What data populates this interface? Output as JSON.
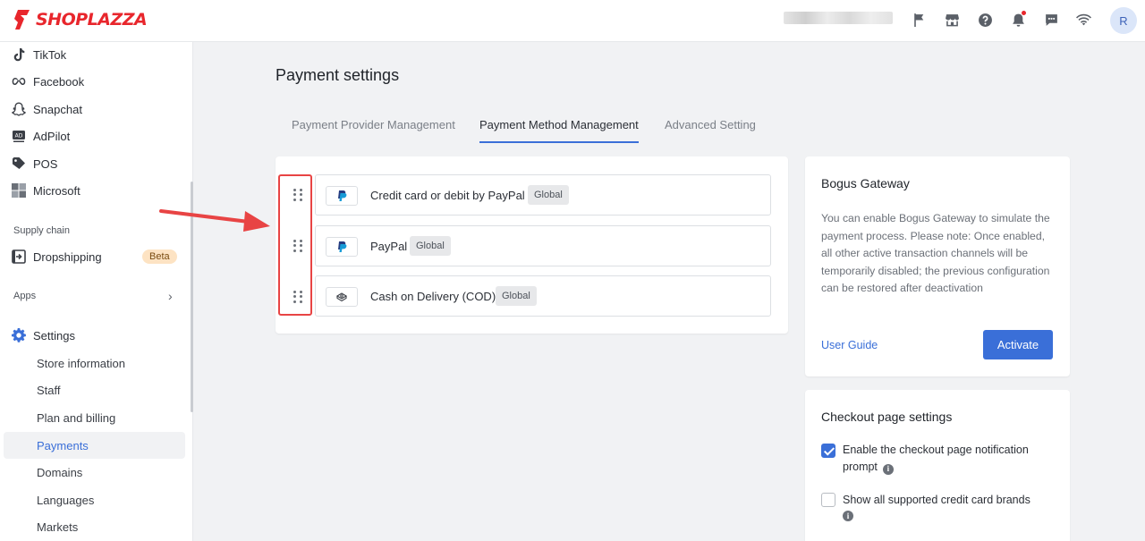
{
  "brand": {
    "name": "SHOPLAZZA"
  },
  "topbar": {
    "avatar_letter": "R",
    "icons": [
      "flag-icon",
      "store-icon",
      "help-icon",
      "bell-icon",
      "message-icon",
      "wifi-icon"
    ]
  },
  "sidebar": {
    "channels": [
      {
        "label": "TikTok",
        "icon": "tiktok-icon"
      },
      {
        "label": "Facebook",
        "icon": "meta-icon"
      },
      {
        "label": "Snapchat",
        "icon": "snapchat-icon"
      },
      {
        "label": "AdPilot",
        "icon": "adpilot-icon"
      },
      {
        "label": "POS",
        "icon": "tag-icon"
      },
      {
        "label": "Microsoft",
        "icon": "microsoft-icon"
      }
    ],
    "supply_chain_heading": "Supply chain",
    "dropshipping": {
      "label": "Dropshipping",
      "badge": "Beta"
    },
    "apps_label": "Apps",
    "settings_label": "Settings",
    "settings_items": [
      {
        "label": "Store information",
        "active": false
      },
      {
        "label": "Staff",
        "active": false
      },
      {
        "label": "Plan and billing",
        "active": false
      },
      {
        "label": "Payments",
        "active": true
      },
      {
        "label": "Domains",
        "active": false
      },
      {
        "label": "Languages",
        "active": false
      },
      {
        "label": "Markets",
        "active": false
      }
    ]
  },
  "main": {
    "title": "Payment settings",
    "tabs": [
      {
        "label": "Payment Provider Management",
        "active": false
      },
      {
        "label": "Payment Method Management",
        "active": true
      },
      {
        "label": "Advanced Setting",
        "active": false
      }
    ],
    "methods": [
      {
        "name": "Credit card or debit by PayPal",
        "tag": "Global",
        "logo": "paypal-icon"
      },
      {
        "name": "PayPal",
        "tag": "Global",
        "logo": "paypal-icon"
      },
      {
        "name": "Cash on Delivery (COD)",
        "tag": "Global",
        "logo": "cash-icon"
      }
    ]
  },
  "bogus_gateway": {
    "title": "Bogus Gateway",
    "description": "You can enable Bogus Gateway to simulate the payment process. Please note: Once enabled, all other active transaction channels will be temporarily disabled; the previous configuration can be restored after deactivation",
    "guide_link": "User Guide",
    "activate_label": "Activate"
  },
  "checkout_settings": {
    "title": "Checkout page settings",
    "options": [
      {
        "label": "Enable the checkout page notification prompt",
        "checked": true
      },
      {
        "label": "Show all supported credit card brands",
        "checked": false
      }
    ]
  },
  "colors": {
    "accent": "#3a6fd8",
    "brand": "#e8262c",
    "annotation": "#e84444"
  }
}
